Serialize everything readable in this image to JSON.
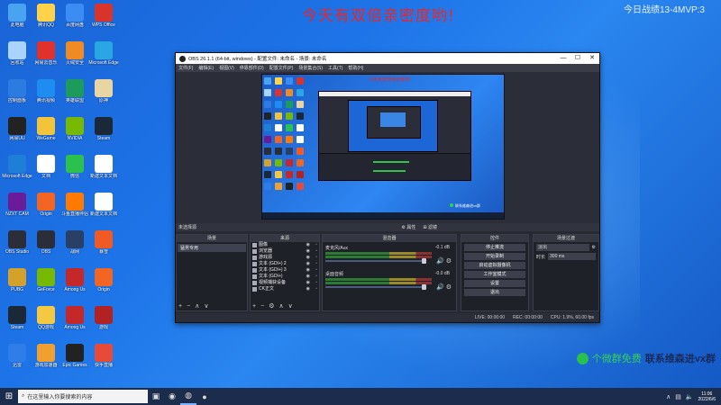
{
  "overlay": {
    "banner": "今天有双倍亲密度哟!",
    "corner": "今日战绩13-4MVP:3",
    "wechat_prefix": "个微群免费",
    "wechat_contact": "联系维森进vx群"
  },
  "desktop": {
    "icons": [
      {
        "label": "此电脑",
        "color": "#4aa3f0"
      },
      {
        "label": "腾讯QQ",
        "color": "#ffd24a"
      },
      {
        "label": "百度网盘",
        "color": "#3b8cf5"
      },
      {
        "label": "WPS Office",
        "color": "#d8342b"
      },
      {
        "label": "回收站",
        "color": "#aad4ff"
      },
      {
        "label": "网易云音乐",
        "color": "#e0312c"
      },
      {
        "label": "火绒安全",
        "color": "#f08a24"
      },
      {
        "label": "Microsoft Edge",
        "color": "#2aa6e4"
      },
      {
        "label": "控制面板",
        "color": "#2c7be0"
      },
      {
        "label": "腾讯视频",
        "color": "#1e8cf0"
      },
      {
        "label": "英雄联盟",
        "color": "#1d9b5a"
      },
      {
        "label": "原神",
        "color": "#e9d5a1"
      },
      {
        "label": "网易UU",
        "color": "#222222"
      },
      {
        "label": "WeGame",
        "color": "#f2c43a"
      },
      {
        "label": "NVIDIA",
        "color": "#76b900"
      },
      {
        "label": "Steam",
        "color": "#1b2838"
      },
      {
        "label": "Microsoft Edge",
        "color": "#1f7fd8"
      },
      {
        "label": "文档",
        "color": "#ffffff"
      },
      {
        "label": "微信",
        "color": "#2cc04c"
      },
      {
        "label": "新建文本文档",
        "color": "#ffffff"
      },
      {
        "label": "NZXT CAM",
        "color": "#6a1b9a"
      },
      {
        "label": "Origin",
        "color": "#f26522"
      },
      {
        "label": "斗鱼直播伴侣",
        "color": "#ff7a00"
      },
      {
        "label": "新建文本文档",
        "color": "#ffffff"
      },
      {
        "label": "OBS Studio",
        "color": "#2b2e38"
      },
      {
        "label": "OBS",
        "color": "#2b2e38"
      },
      {
        "label": "战网",
        "color": "#2a3f66"
      },
      {
        "label": "暴雪",
        "color": "#f15a24"
      },
      {
        "label": "PUBG",
        "color": "#d4a12a"
      },
      {
        "label": "GeForce",
        "color": "#76b900"
      },
      {
        "label": "Among Us",
        "color": "#c52828"
      },
      {
        "label": "Origin",
        "color": "#f26522"
      },
      {
        "label": "Steam",
        "color": "#1b2838"
      },
      {
        "label": "QQ游戏",
        "color": "#f5c842"
      },
      {
        "label": "Among Us",
        "color": "#c52828"
      },
      {
        "label": "游戏",
        "color": "#b22222"
      },
      {
        "label": "迅雷",
        "color": "#2e7de8"
      },
      {
        "label": "游戏加速器",
        "color": "#f0a030"
      },
      {
        "label": "Epic Games",
        "color": "#222222"
      },
      {
        "label": "快手直播",
        "color": "#e84a3a"
      }
    ]
  },
  "obs": {
    "title": "OBS 26.1.1 (64-bit, windows) - 配置文件: 未命名 - 场景: 未命名",
    "menus": [
      "文件(F)",
      "编辑(E)",
      "视图(V)",
      "停靠部件(D)",
      "配置文件(P)",
      "场景集合(S)",
      "工具(T)",
      "帮助(H)"
    ],
    "window_controls": [
      "—",
      "☐",
      "✕"
    ],
    "preview_banner": "今天有双倍亲密度哟!",
    "preview_chip": "联系维森进vx群",
    "dock_row_label": "未选择源",
    "dock_row_props": "⚙ 属性",
    "dock_row_filters": "⊞ 滤镜",
    "scenes": {
      "header": "场景",
      "items": [
        "猛男专用"
      ]
    },
    "sources": {
      "header": "来源",
      "items": [
        "图像",
        "浏览器",
        "游戏源",
        "文本 (GDI+) 2",
        "文本 (GDI+) 3",
        "文本 (GDI+)",
        "视频捕获设备",
        "CK正文"
      ]
    },
    "mixer": {
      "header": "混音器",
      "tracks": [
        {
          "name": "麦克风/Aux",
          "db": "-0.1 dB"
        },
        {
          "name": "桌面音频",
          "db": "-0.0 dB"
        }
      ]
    },
    "transitions": {
      "header": "场景过渡",
      "selected": "淡出",
      "duration_label": "时长",
      "duration_value": "300 ms"
    },
    "controls": {
      "header": "控件",
      "buttons": [
        "停止推流",
        "开始录制",
        "启动虚拟摄像机",
        "工作室模式",
        "设置",
        "退出"
      ]
    },
    "status": {
      "live": "LIVE: 00:00:00",
      "rec": "REC: 00:00:00",
      "cpu": "CPU: 1.9%, 60.00 fps"
    },
    "dock_foot_icons": [
      "+",
      "−",
      "⚙",
      "∧",
      "∨"
    ]
  },
  "taskbar": {
    "search_placeholder": "在这里输入你要搜索的内容",
    "time": "11:06",
    "date": "2022/6/6"
  }
}
